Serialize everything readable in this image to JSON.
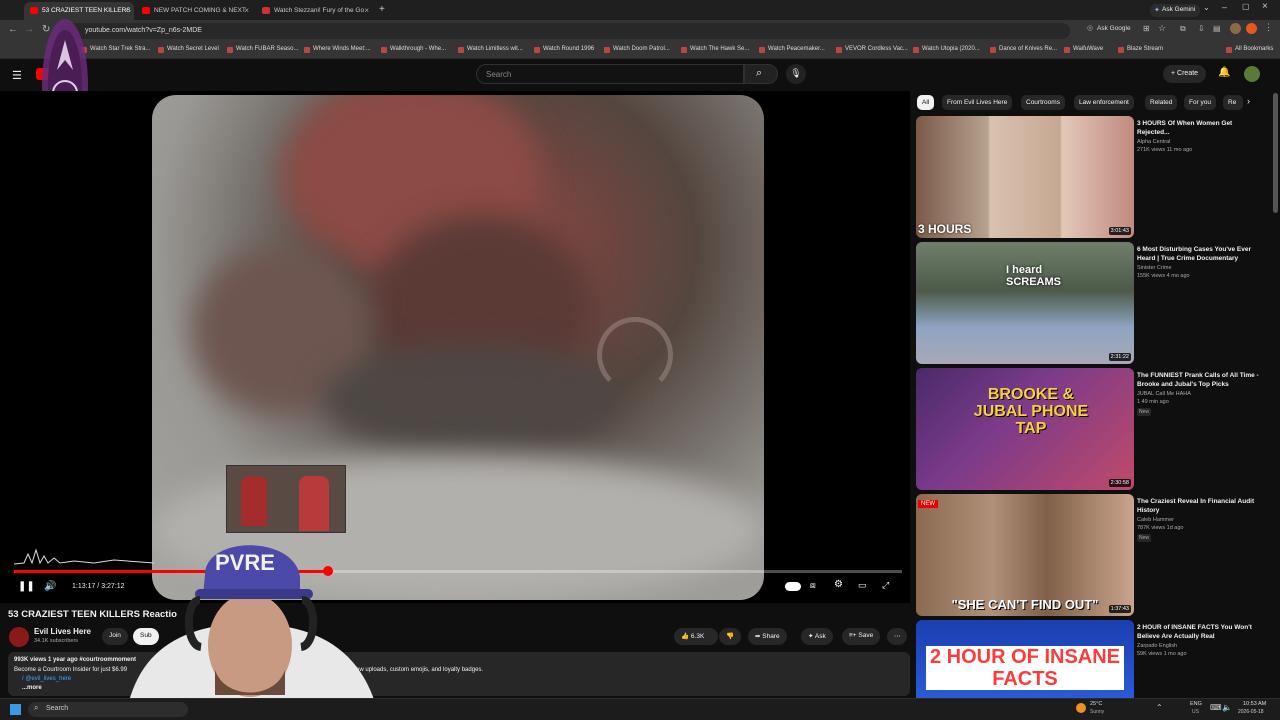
{
  "tabs": [
    {
      "label": "53 CRAZIEST TEEN KILLERS",
      "active": true
    },
    {
      "label": "NEW PATCH COMING & NEXT",
      "active": false
    },
    {
      "label": "Watch Stezzani! Fury of the Go",
      "active": false
    }
  ],
  "browser": {
    "url": "youtube.com/watch?v=Zp_n6s-2MDE",
    "ask_gemini": "Ask Gemini",
    "ask_google": "Ask Google",
    "all_bookmarks": "All Bookmarks"
  },
  "bookmarks": [
    "Watch Star Trek Stra...",
    "Watch Secret Level",
    "Watch FUBAR Seaso...",
    "Where Winds Meet:...",
    "Walkthrough - Whe...",
    "Watch Limitless wit...",
    "Watch Round 1996",
    "Watch Doom Patrol...",
    "Watch The Hawk Se...",
    "Watch Peacemaker...",
    "VEVOR Cordless Vac...",
    "Watch Utopia (2020...",
    "Dance of Knives Re...",
    "WaifuWave",
    "Blaze Stream"
  ],
  "youtube": {
    "search_placeholder": "Search",
    "create_label": "Create"
  },
  "chips": [
    "All",
    "From Evil Lives Here",
    "Courtrooms",
    "Law enforcement",
    "Related",
    "For you",
    "Re"
  ],
  "player": {
    "time": "1:13:17 / 3:27:12",
    "progress": 0.354
  },
  "video": {
    "title": "53 CRAZIEST TEEN KILLERS Reactio",
    "channel": "Evil Lives Here",
    "subscribers": "34.1K subscribers",
    "join_label": "Join",
    "subscribe_label": "Sub",
    "likes": "6.3K",
    "share_label": "Share",
    "ask_label": "Ask",
    "save_label": "Save",
    "views_line": "993K views  1 year ago  #courtroommoment",
    "desc_line1": "Become a Courtroom Insider for just $6.99",
    "desc_line1_tail": "ew uploads, custom emojis, and loyalty badges.",
    "desc_line2": "/ @evil_lives_here",
    "more_label": "...more"
  },
  "recommendations": [
    {
      "title": "3 HOURS Of When Women Get Rejected...",
      "channel": "Alpha Central",
      "meta": "271K views  11 mo ago",
      "duration": "3:01:43",
      "overlay": "3 HOURS",
      "new": false
    },
    {
      "title": "6 Most Disturbing Cases You've Ever Heard | True Crime Documentary",
      "channel": "Sinister Crime",
      "meta": "155K views  4 mo ago",
      "duration": "2:31:22",
      "overlay": "I heard SCREAMS",
      "new": false
    },
    {
      "title": "The FUNNIEST Prank Calls of All Time - Brooke and Jubal's Top Picks",
      "channel": "JUBAL Call Me HAHA",
      "meta": "1  49 min ago",
      "duration": "2:30:58",
      "overlay": "BROOKE & JUBAL PHONE TAP",
      "new": true
    },
    {
      "title": "The Craziest Reveal In Financial Audit History",
      "channel": "Caleb Hammer",
      "meta": "787K views  1d ago",
      "duration": "1:37:43",
      "overlay": "\"SHE CAN'T FIND OUT\"",
      "new": true
    },
    {
      "title": "2 HOUR of INSANE FACTS You Won't Believe Are Actually Real",
      "channel": "Zarpado English",
      "meta": "59K views  1 mo ago",
      "duration": "",
      "overlay": "2 HOUR OF INSANE FACTS",
      "new": false
    }
  ],
  "taskbar": {
    "search_placeholder": "Search",
    "weather": "25°C",
    "weather_desc": "Sunny",
    "lang": "ENG",
    "region": "US",
    "time": "10:53 AM",
    "date": "2026-05-18"
  }
}
